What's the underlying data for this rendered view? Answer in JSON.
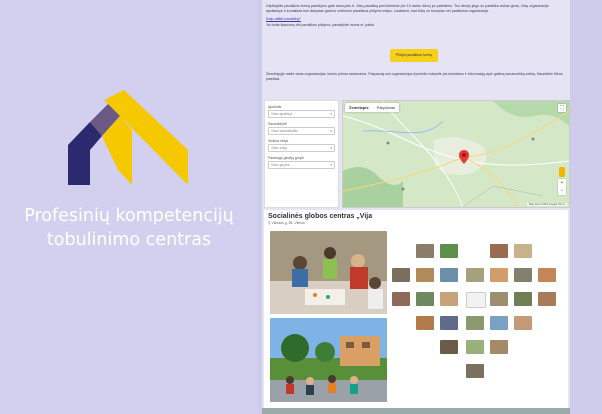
{
  "brand": {
    "tagline_line1": "Profesinių kompetencijų",
    "tagline_line2": "tobulinimo centras",
    "logo_colors": {
      "yellow": "#f5c800",
      "navy": "#2b2a6e",
      "gray": "#6b5a86"
    }
  },
  "intro": {
    "paragraph": "Užpildykite paraiškos formą pasiūlymo gale www.pktc.lt. Jūsų paraišką peržiūrėsime per 10 darbo dienų po pateikimo. Tuo atveju jeigu su paraiška viskas gerai, Jūsų organizacija apsilankys ir kontaktas bus išsiųstas gavimo vertinimo paraiškos pildymo etapu. Laukiame, kad būtų ne trumpiau nei pasitikima organizacija.",
    "question_link": "Kaip atlikti paraišką?",
    "contact_text": "Jei turite klausimų dėl paraiškos pildymo, parašykite mums el. paštu",
    "cta_label": "Pildyti paraiškos formą",
    "paragraph2": "Žemėlapyje rasite visas organizacijas, kurios priima savanorius. Paspaudę ant organizacijos žymeklio matysite jos kontaktus ir informaciją apie galimą savanorišką veiklą. Naudokite filtrus paieškai."
  },
  "filters": {
    "fields": [
      {
        "label": "Apskritis",
        "value": "Visos apskritys"
      },
      {
        "label": "Savivaldybė",
        "value": "Visos savivaldybės"
      },
      {
        "label": "Veiklos sritys",
        "value": "Visos sritys"
      },
      {
        "label": "Paslaugų gavėjų grupė",
        "value": "Visos grupės"
      }
    ]
  },
  "map": {
    "tabs": [
      "Žemėlapis",
      "Palydovas"
    ],
    "active_tab": "Žemėlapis",
    "attribution": "Map data ©2023 Google  Terms",
    "marker_color": "#e53935"
  },
  "organization": {
    "title": "Socialinės globos centras „Vija",
    "address": "Vilniaus g. 55, Vilnius"
  }
}
